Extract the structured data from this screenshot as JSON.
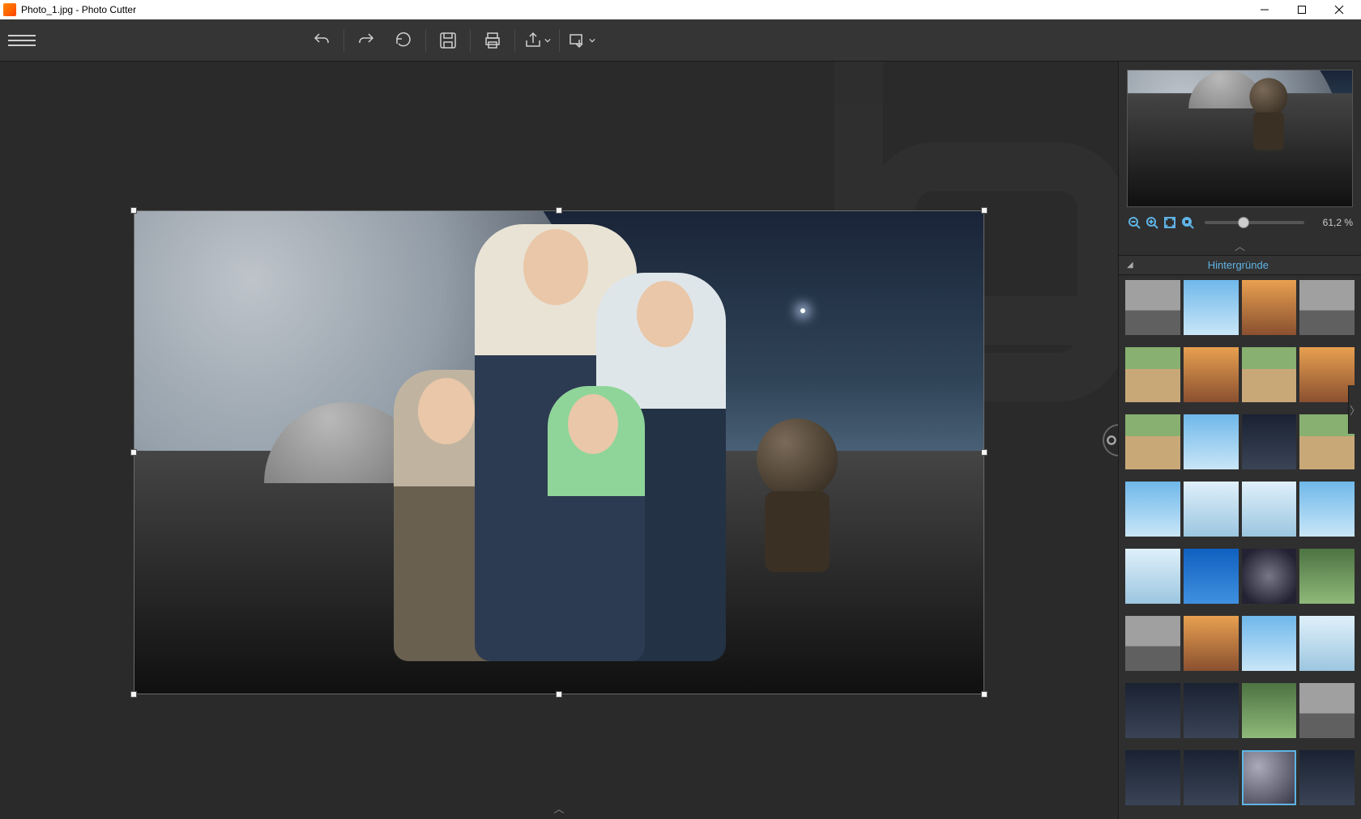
{
  "titlebar": {
    "document_name": "Photo_1.jpg",
    "app_name": "Photo Cutter",
    "separator": " - "
  },
  "zoom": {
    "value_text": "61,2 %",
    "value": 61.2
  },
  "side_panel": {
    "header_title": "Hintergründe"
  },
  "background_thumbs": [
    {
      "name": "bridge",
      "cls": "city"
    },
    {
      "name": "eiffel",
      "cls": "sky"
    },
    {
      "name": "pyramids",
      "cls": "warm"
    },
    {
      "name": "rushmore",
      "cls": "city"
    },
    {
      "name": "road",
      "cls": "land"
    },
    {
      "name": "waterfall",
      "cls": "warm"
    },
    {
      "name": "desert",
      "cls": "land"
    },
    {
      "name": "bicycle",
      "cls": "warm"
    },
    {
      "name": "canyon-river",
      "cls": "land"
    },
    {
      "name": "island",
      "cls": "sky"
    },
    {
      "name": "storm",
      "cls": "dark"
    },
    {
      "name": "cliff",
      "cls": "land"
    },
    {
      "name": "open-sky",
      "cls": "sky"
    },
    {
      "name": "icebergs",
      "cls": "ice"
    },
    {
      "name": "snow",
      "cls": "ice"
    },
    {
      "name": "venice",
      "cls": "sky"
    },
    {
      "name": "wedding",
      "cls": "ice"
    },
    {
      "name": "love-you",
      "cls": "blue"
    },
    {
      "name": "space-station",
      "cls": "metal"
    },
    {
      "name": "rocky-stream",
      "cls": "green"
    },
    {
      "name": "western",
      "cls": "city"
    },
    {
      "name": "silhouette",
      "cls": "warm"
    },
    {
      "name": "beach-jump",
      "cls": "sky"
    },
    {
      "name": "misty",
      "cls": "ice"
    },
    {
      "name": "lion",
      "cls": "dark"
    },
    {
      "name": "mountain-dog",
      "cls": "dark"
    },
    {
      "name": "pterodactyl",
      "cls": "green"
    },
    {
      "name": "ufo",
      "cls": "city"
    },
    {
      "name": "forest",
      "cls": "dark"
    },
    {
      "name": "tunnel",
      "cls": "dark"
    },
    {
      "name": "moon-robot",
      "cls": "moon",
      "selected": true
    },
    {
      "name": "moon-plain",
      "cls": "dark"
    }
  ]
}
